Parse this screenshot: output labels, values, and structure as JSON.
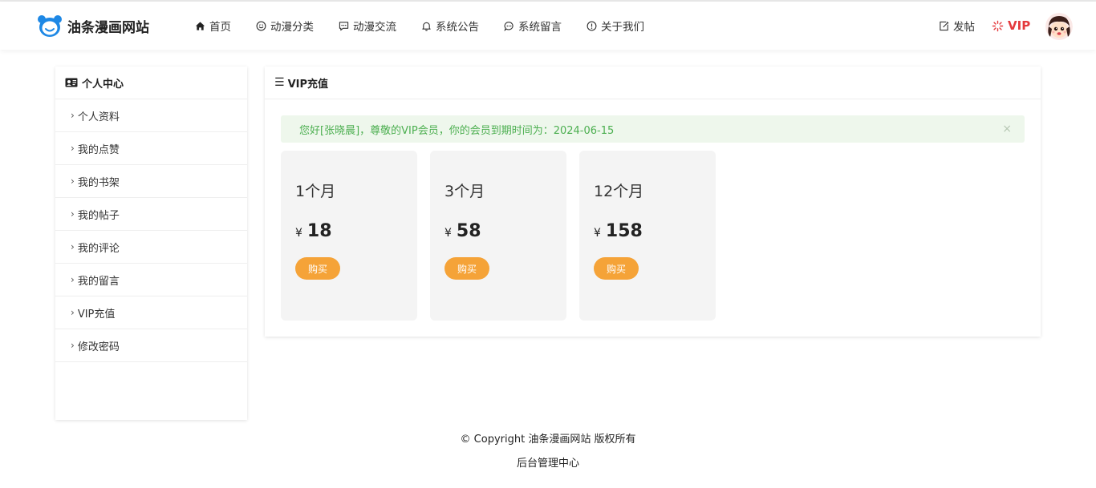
{
  "header": {
    "logo_text": "油条漫画网站",
    "nav": [
      {
        "label": "首页",
        "icon": "home-icon"
      },
      {
        "label": "动漫分类",
        "icon": "smile-icon"
      },
      {
        "label": "动漫交流",
        "icon": "message-icon"
      },
      {
        "label": "系统公告",
        "icon": "bell-icon"
      },
      {
        "label": "系统留言",
        "icon": "chat-icon"
      },
      {
        "label": "关于我们",
        "icon": "info-icon"
      }
    ],
    "post_label": "发帖",
    "vip_label": "VIP"
  },
  "sidebar": {
    "title": "个人中心",
    "items": [
      {
        "label": "个人资料"
      },
      {
        "label": "我的点赞"
      },
      {
        "label": "我的书架"
      },
      {
        "label": "我的帖子"
      },
      {
        "label": "我的评论"
      },
      {
        "label": "我的留言"
      },
      {
        "label": "VIP充值"
      },
      {
        "label": "修改密码"
      }
    ]
  },
  "main": {
    "title": "VIP充值",
    "alert": "您好[张晓晨]，尊敬的VIP会员，你的会员到期时间为：2024-06-15",
    "alert_close": "×",
    "plans": [
      {
        "title": "1个月",
        "currency": "¥",
        "price": "18",
        "buy_label": "购买"
      },
      {
        "title": "3个月",
        "currency": "¥",
        "price": "58",
        "buy_label": "购买"
      },
      {
        "title": "12个月",
        "currency": "¥",
        "price": "158",
        "buy_label": "购买"
      }
    ]
  },
  "footer": {
    "copyright": "© Copyright 油条漫画网站 版权所有",
    "admin_link": "后台管理中心"
  },
  "colors": {
    "accent_orange": "#f5a338",
    "vip_red": "#e4393c",
    "logo_blue": "#1e88e5",
    "alert_green": "#4caf50",
    "alert_bg": "#eef7ec"
  }
}
